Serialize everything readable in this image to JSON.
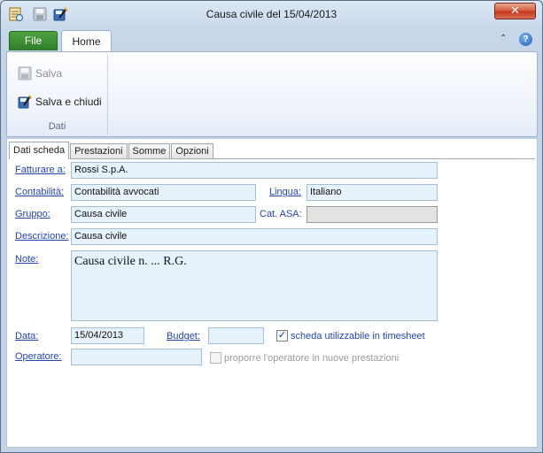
{
  "window": {
    "title": "Causa civile del 15/04/2013",
    "close_glyph": "✕"
  },
  "ribbon": {
    "tabs": {
      "file": "File",
      "home": "Home"
    },
    "minimize_glyph": "⌃",
    "help_glyph": "?",
    "group_dati": {
      "label": "Dati",
      "save": "Salva",
      "save_close": "Salva e chiudi"
    }
  },
  "form": {
    "tabs": [
      "Dati scheda",
      "Prestazioni",
      "Somme",
      "Opzioni"
    ],
    "labels": {
      "fatturare": "Fatturare a:",
      "contabilita": "Contabilità:",
      "lingua": "Lingua:",
      "gruppo": "Gruppo:",
      "cat_asa": "Cat. ASA:",
      "descrizione": "Descrizione:",
      "note": "Note:",
      "data": "Data:",
      "budget": "Budget:",
      "operatore": "Operatore:"
    },
    "values": {
      "fatturare": "Rossi S.p.A.",
      "contabilita": "Contabilità avvocati",
      "lingua": "Italiano",
      "gruppo": "Causa civile",
      "cat_asa": "",
      "descrizione": "Causa civile",
      "note": "Causa civile n. ... R.G.",
      "data": "15/04/2013",
      "budget": "",
      "operatore": ""
    },
    "checkboxes": {
      "timesheet": {
        "label": "scheda utilizzabile in timesheet",
        "checked": true,
        "mark": "✓"
      },
      "proporre": {
        "label": "proporre l'operatore in nuove prestazioni",
        "checked": false,
        "mark": ""
      }
    }
  },
  "icons": {
    "app": "app-icon",
    "qat_save": "save-icon",
    "qat_save_close": "save-close-icon"
  },
  "colors": {
    "file_tab": "#2e7d28",
    "label_link": "#2346a8",
    "field_bg": "#e6f2fb",
    "close_button": "#c3341b"
  }
}
